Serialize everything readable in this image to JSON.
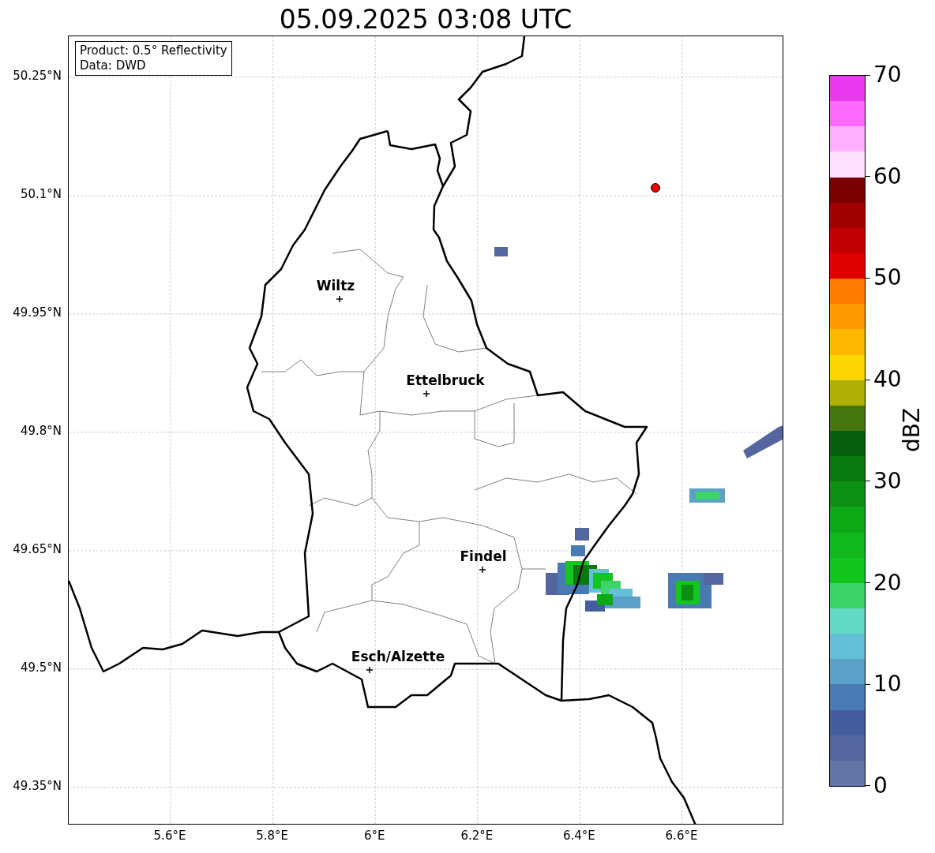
{
  "title": "05.09.2025 03:08 UTC",
  "info_box": {
    "lines": [
      "Product: 0.5° Reflectivity",
      "Data: DWD"
    ]
  },
  "map": {
    "y_ticks": [
      "50.25°N",
      "50.1°N",
      "49.95°N",
      "49.8°N",
      "49.65°N",
      "49.5°N",
      "49.35°N"
    ],
    "x_ticks": [
      "5.6°E",
      "5.8°E",
      "6°E",
      "6.2°E",
      "6.4°E",
      "6.6°E"
    ],
    "cities": [
      {
        "name": "Wiltz"
      },
      {
        "name": "Ettelbruck"
      },
      {
        "name": "Findel"
      },
      {
        "name": "Esch/Alzette"
      }
    ]
  },
  "colorbar": {
    "label": "dBZ",
    "ticks": [
      "70",
      "60",
      "50",
      "40",
      "30",
      "20",
      "10",
      "0"
    ],
    "bins": [
      {
        "color": "#e839ee"
      },
      {
        "color": "#ff6aff"
      },
      {
        "color": "#ffb0ff"
      },
      {
        "color": "#ffe0ff"
      },
      {
        "color": "#7a0000"
      },
      {
        "color": "#a00000"
      },
      {
        "color": "#c00000"
      },
      {
        "color": "#e00000"
      },
      {
        "color": "#ff7c00"
      },
      {
        "color": "#ff9900"
      },
      {
        "color": "#ffb900"
      },
      {
        "color": "#ffd700"
      },
      {
        "color": "#b0b007"
      },
      {
        "color": "#46770f"
      },
      {
        "color": "#075f0d"
      },
      {
        "color": "#0a7a10"
      },
      {
        "color": "#0d8f13"
      },
      {
        "color": "#0ea716"
      },
      {
        "color": "#10b81c"
      },
      {
        "color": "#12c61f"
      },
      {
        "color": "#3dd46a"
      },
      {
        "color": "#61d9c4"
      },
      {
        "color": "#65bfd8"
      },
      {
        "color": "#5aa0c8"
      },
      {
        "color": "#4a7ab3"
      },
      {
        "color": "#445d9f"
      },
      {
        "color": "#5465a0"
      },
      {
        "color": "#6374a6"
      }
    ]
  }
}
